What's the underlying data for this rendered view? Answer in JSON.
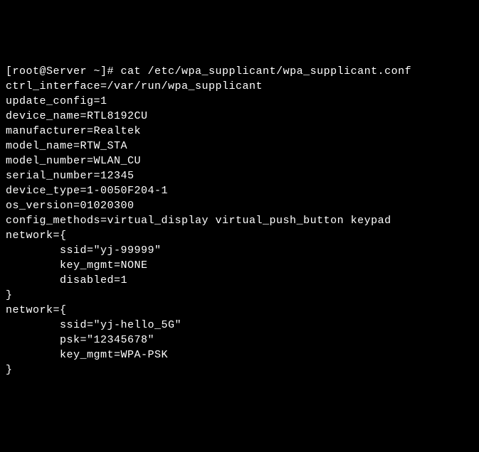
{
  "prompt": "[root@Server ~]# ",
  "command": "cat /etc/wpa_supplicant/wpa_supplicant.conf",
  "config": {
    "ctrl_interface": "ctrl_interface=/var/run/wpa_supplicant",
    "update_config": "update_config=1",
    "device_name": "device_name=RTL8192CU",
    "manufacturer": "manufacturer=Realtek",
    "model_name": "model_name=RTW_STA",
    "model_number": "model_number=WLAN_CU",
    "serial_number": "serial_number=12345",
    "device_type": "device_type=1-0050F204-1",
    "os_version": "os_version=01020300",
    "config_methods": "config_methods=virtual_display virtual_push_button keypad"
  },
  "blank1": "",
  "net1": {
    "open": "network={",
    "ssid": "        ssid=\"yj-99999\"",
    "key_mgmt": "        key_mgmt=NONE",
    "disabled": "        disabled=1",
    "close": "}"
  },
  "blank2": "",
  "net2": {
    "open": "network={",
    "ssid": "        ssid=\"yj-hello_5G\"",
    "psk": "        psk=\"12345678\"",
    "key_mgmt": "        key_mgmt=WPA-PSK",
    "close": "}"
  }
}
